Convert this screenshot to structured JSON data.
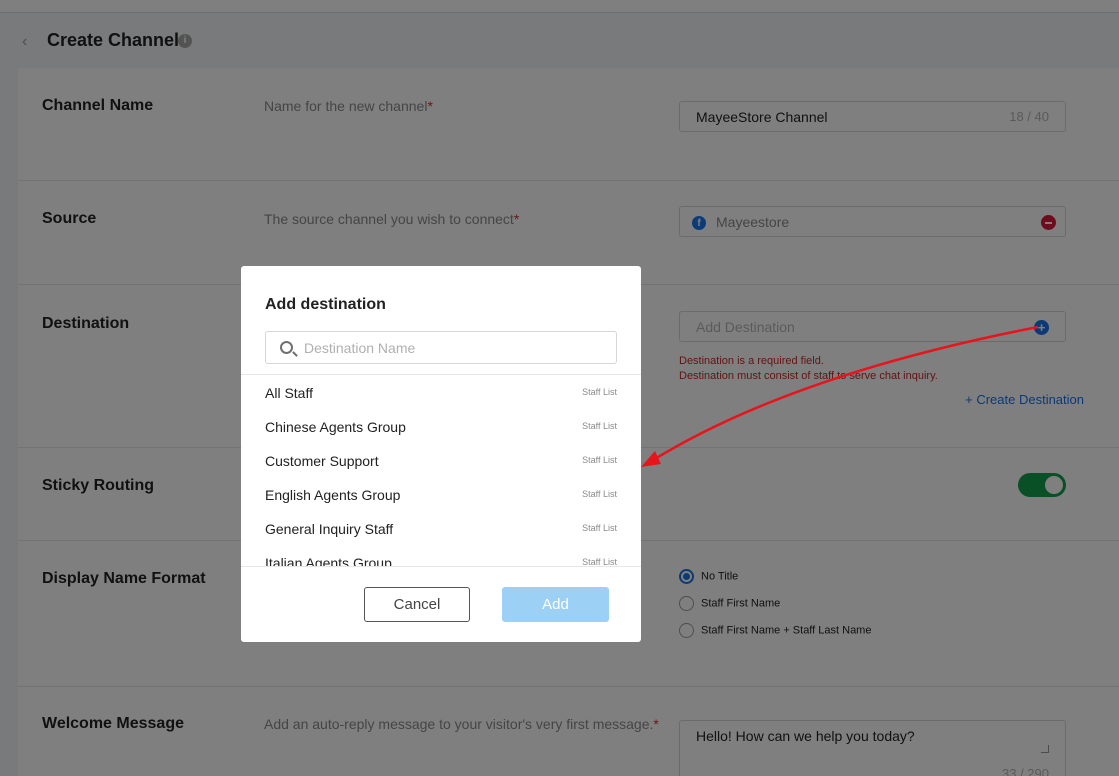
{
  "header": {
    "title": "Create Channel",
    "back_icon": "chevron-left-icon",
    "info_icon": "info-icon"
  },
  "channel_name": {
    "label": "Channel Name",
    "desc": "Name for the new channel",
    "value": "MayeeStore Channel",
    "count": "18 / 40"
  },
  "source": {
    "label": "Source",
    "desc": "The source channel you wish to connect",
    "value": "Mayeestore",
    "icon": "facebook-icon"
  },
  "destination": {
    "label": "Destination",
    "placeholder": "Add Destination",
    "error1": "Destination is a required field.",
    "error2": "Destination must consist of staff to serve chat inquiry.",
    "create_link": "+ Create Destination"
  },
  "sticky_routing": {
    "label": "Sticky Routing",
    "enabled": true
  },
  "display_name_format": {
    "label": "Display Name Format",
    "options": [
      "No Title",
      "Staff First Name",
      "Staff First Name + Staff Last Name"
    ],
    "selected": "No Title"
  },
  "welcome_message": {
    "label": "Welcome Message",
    "desc": "Add an auto-reply message to your visitor's very first message.",
    "value": "Hello! How can we help you today?",
    "count": "33 / 290"
  },
  "modal": {
    "title": "Add destination",
    "search_placeholder": "Destination Name",
    "items": [
      {
        "name": "All Staff",
        "tag": "Staff List"
      },
      {
        "name": "Chinese Agents Group",
        "tag": "Staff List"
      },
      {
        "name": "Customer Support",
        "tag": "Staff List"
      },
      {
        "name": "English Agents Group",
        "tag": "Staff List"
      },
      {
        "name": "General Inquiry Staff",
        "tag": "Staff List"
      },
      {
        "name": "Italian Agents Group",
        "tag": "Staff List"
      }
    ],
    "cancel_label": "Cancel",
    "add_label": "Add"
  },
  "colors": {
    "accent": "#1a73e8",
    "error": "#c62828",
    "toggle_on": "#14a14d",
    "add_disabled": "#9dd0f5",
    "annotation_arrow": "#e8141b"
  }
}
